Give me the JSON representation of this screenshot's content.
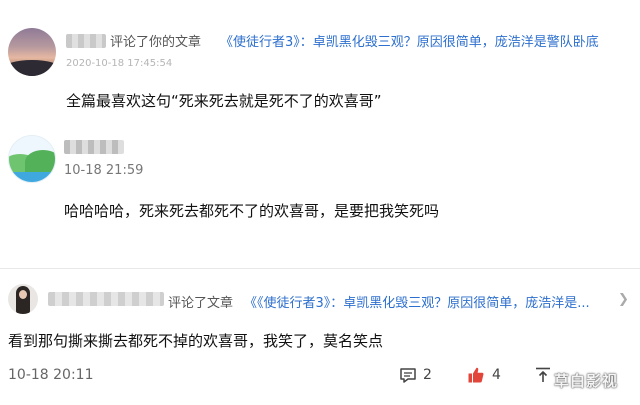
{
  "comments": [
    {
      "action": "评论了你的文章",
      "article": "《使徒行者3》：卓凯黑化毁三观？原因很简单，庞浩洋是警队卧底",
      "time": "2020-10-18 17:45:54",
      "text": "全篇最喜欢这句“死来死去就是死不了的欢喜哥”"
    },
    {
      "time": "10-18 21:59",
      "text": "哈哈哈哈，死来死去都死不了的欢喜哥，是要把我笑死吗"
    },
    {
      "action": "评论了文章",
      "article": "《《使徒行者3》：卓凯黑化毁三观？原因很简单，庞浩洋是...",
      "text": "看到那句撕来撕去都死不掉的欢喜哥，我笑了，莫名笑点",
      "time": "10-18 20:11",
      "comment_count": "2",
      "like_count": "4"
    }
  ],
  "icons": {
    "comment": "comment-icon",
    "like": "thumbs-up-icon",
    "share": "share-icon",
    "more": "chevron-right-icon"
  },
  "colors": {
    "link": "#2d6fce",
    "like": "#e2463a"
  },
  "watermark": "草白影视"
}
